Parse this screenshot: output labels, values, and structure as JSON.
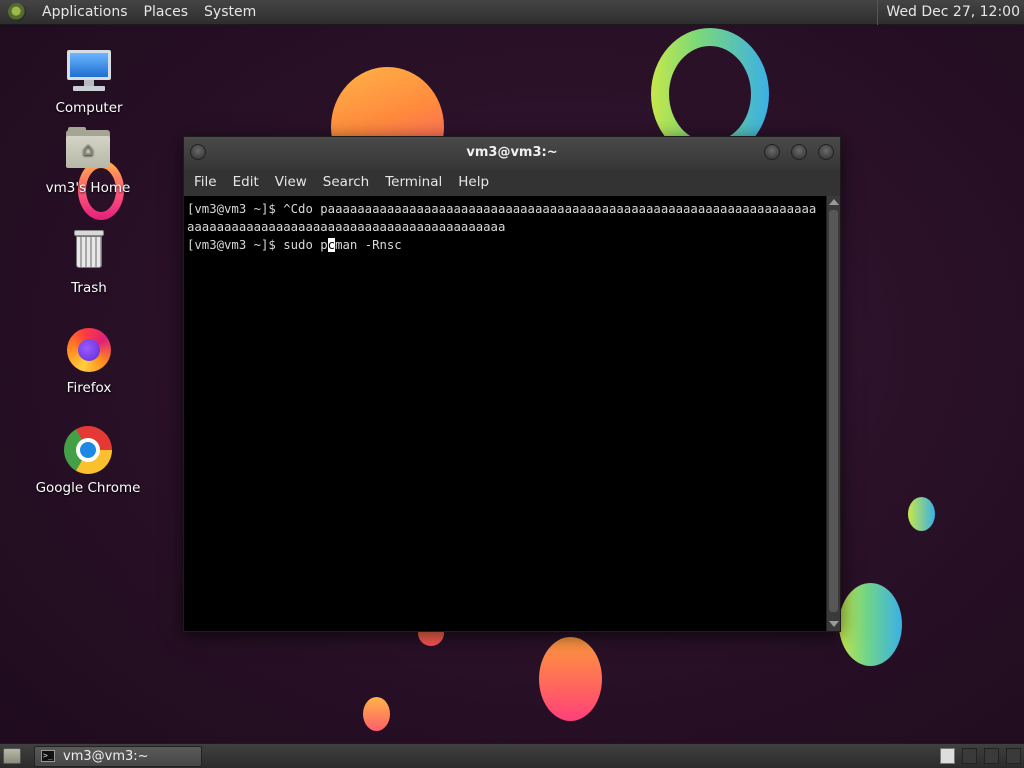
{
  "top_panel": {
    "menus": [
      "Applications",
      "Places",
      "System"
    ],
    "clock": "Wed Dec 27, 12:00"
  },
  "desktop_icons": [
    {
      "label": "Computer",
      "icon": "computer-icon"
    },
    {
      "label": "vm3's Home",
      "icon": "home-folder-icon"
    },
    {
      "label": "Trash",
      "icon": "trash-icon"
    },
    {
      "label": "Firefox",
      "icon": "firefox-icon"
    },
    {
      "label": "Google Chrome",
      "icon": "chrome-icon"
    }
  ],
  "terminal": {
    "title": "vm3@vm3:~",
    "menus": [
      "File",
      "Edit",
      "View",
      "Search",
      "Terminal",
      "Help"
    ],
    "lines": [
      "[vm3@vm3 ~]$ ^Cdo paaaaaaaaaaaaaaaaaaaaaaaaaaaaaaaaaaaaaaaaaaaaaaaaaaaaaaaaaaaaaaaaaa",
      "aaaaaaaaaaaaaaaaaaaaaaaaaaaaaaaaaaaaaaaaaaa"
    ],
    "prompt_before_cursor": "[vm3@vm3 ~]$ sudo p",
    "cursor_char": "c",
    "prompt_after_cursor": "man -Rnsc",
    "background": "#000000",
    "foreground": "#d8d8d8"
  },
  "taskbar": {
    "tasks": [
      {
        "label": "vm3@vm3:~",
        "icon": "terminal-icon"
      }
    ],
    "workspaces": 4,
    "active_workspace": 1
  }
}
